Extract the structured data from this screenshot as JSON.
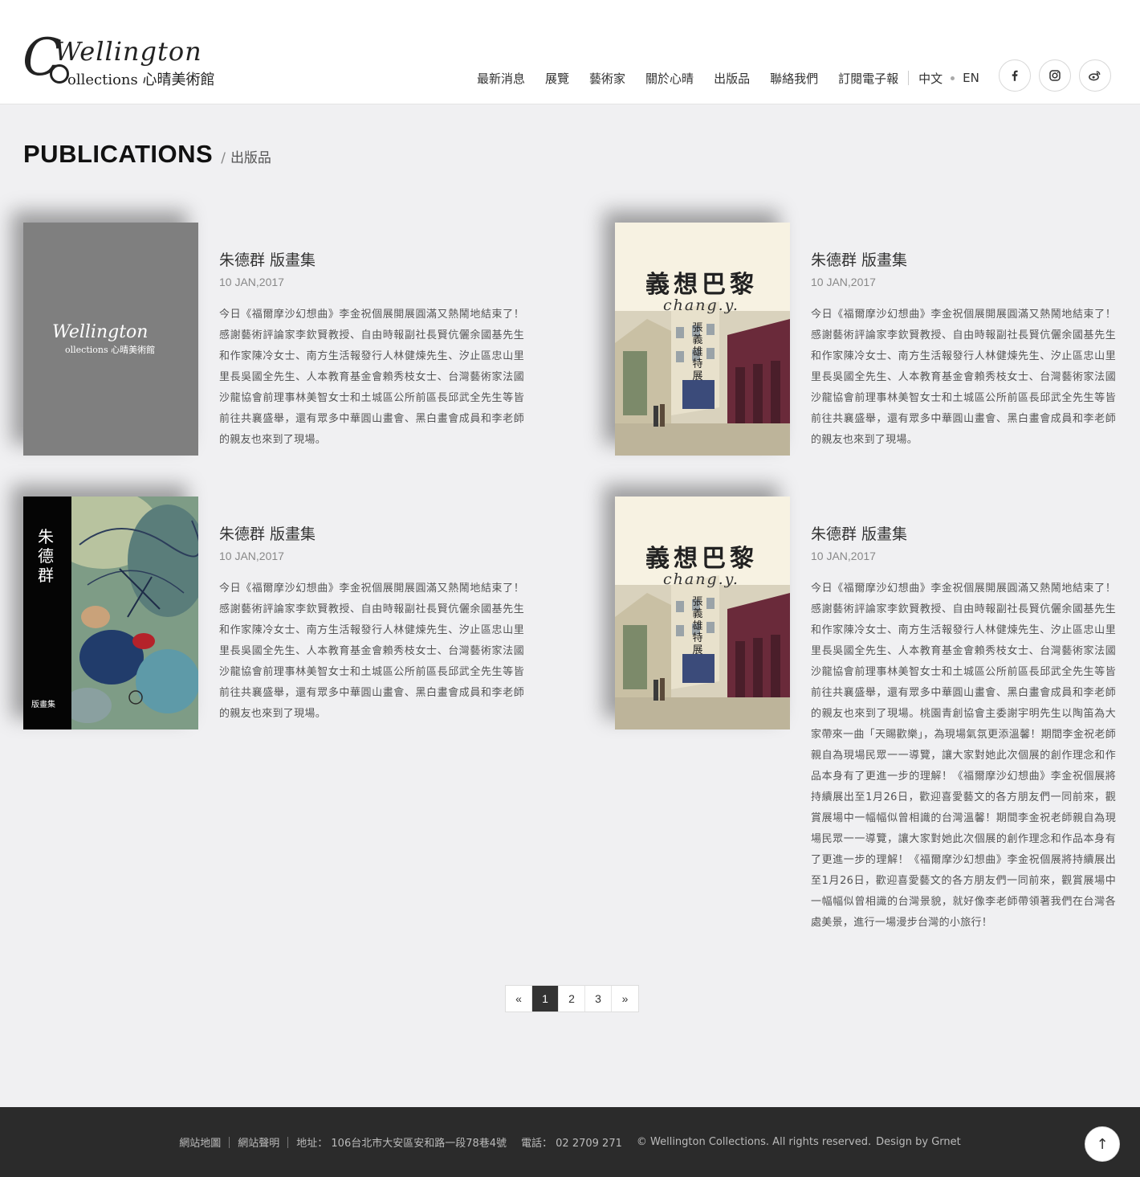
{
  "header": {
    "logo": {
      "word": "Wellington",
      "sub": "ollections 心晴美術館"
    },
    "nav": [
      "最新消息",
      "展覽",
      "藝術家",
      "關於心晴",
      "出版品",
      "聯絡我們",
      "訂閱電子報"
    ],
    "lang": {
      "zh": "中文",
      "en": "EN"
    },
    "social": [
      "facebook-icon",
      "instagram-icon",
      "weibo-icon"
    ]
  },
  "page": {
    "title_en": "PUBLICATIONS",
    "slash": "/",
    "title_zh": "出版品"
  },
  "publications": [
    {
      "cover": "wellington-logo-cover",
      "cover_text": {
        "word": "Wellington",
        "sub": "ollections 心晴美術館"
      },
      "title": "朱德群 版畫集",
      "date": "10 JAN,2017",
      "body": "今日《福爾摩沙幻想曲》李金祝個展開展圓滿又熱鬧地結束了！感謝藝術評論家李欽賢教授、自由時報副社長賢伉儷余國基先生和作家陳冷女士、南方生活報發行人林健煉先生、汐止區忠山里里長吳國全先生、人本教育基金會賴秀枝女士、台灣藝術家法國沙龍協會前理事林美智女士和土城區公所前區長邱武全先生等皆前往共襄盛舉，還有眾多中華圓山畫會、黑白畫會成員和李老師的親友也來到了現場。"
    },
    {
      "cover": "paris-cover",
      "cover_text": {
        "title": "義想巴黎",
        "signature": "chang.y.",
        "vertical": "張義雄特展"
      },
      "title": "朱德群 版畫集",
      "date": "10 JAN,2017",
      "body": "今日《福爾摩沙幻想曲》李金祝個展開展圓滿又熱鬧地結束了！感謝藝術評論家李欽賢教授、自由時報副社長賢伉儷余國基先生和作家陳冷女士、南方生活報發行人林健煉先生、汐止區忠山里里長吳國全先生、人本教育基金會賴秀枝女士、台灣藝術家法國沙龍協會前理事林美智女士和土城區公所前區長邱武全先生等皆前往共襄盛舉，還有眾多中華圓山畫會、黑白畫會成員和李老師的親友也來到了現場。"
    },
    {
      "cover": "zhu-dequn-cover",
      "cover_text": {
        "vertical": "朱德群",
        "bottom": "版畫集"
      },
      "title": "朱德群 版畫集",
      "date": "10 JAN,2017",
      "body": "今日《福爾摩沙幻想曲》李金祝個展開展圓滿又熱鬧地結束了！感謝藝術評論家李欽賢教授、自由時報副社長賢伉儷余國基先生和作家陳冷女士、南方生活報發行人林健煉先生、汐止區忠山里里長吳國全先生、人本教育基金會賴秀枝女士、台灣藝術家法國沙龍協會前理事林美智女士和土城區公所前區長邱武全先生等皆前往共襄盛舉，還有眾多中華圓山畫會、黑白畫會成員和李老師的親友也來到了現場。"
    },
    {
      "cover": "paris-cover",
      "cover_text": {
        "title": "義想巴黎",
        "signature": "chang.y.",
        "vertical": "張義雄特展"
      },
      "title": "朱德群 版畫集",
      "date": "10 JAN,2017",
      "body": "今日《福爾摩沙幻想曲》李金祝個展開展圓滿又熱鬧地結束了！感謝藝術評論家李欽賢教授、自由時報副社長賢伉儷余國基先生和作家陳冷女士、南方生活報發行人林健煉先生、汐止區忠山里里長吳國全先生、人本教育基金會賴秀枝女士、台灣藝術家法國沙龍協會前理事林美智女士和土城區公所前區長邱武全先生等皆前往共襄盛舉，還有眾多中華圓山畫會、黑白畫會成員和李老師的親友也來到了現場。桃園青創協會主委謝宇明先生以陶笛為大家帶來一曲「天賜歡樂」，為現場氣氛更添溫馨！期間李金祝老師親自為現場民眾一一導覽，讓大家對她此次個展的創作理念和作品本身有了更進一步的理解！《福爾摩沙幻想曲》李金祝個展將持續展出至1月26日，歡迎喜愛藝文的各方朋友們一同前來，觀賞展場中一幅幅似曾相識的台灣溫馨！期間李金祝老師親自為現場民眾一一導覽，讓大家對她此次個展的創作理念和作品本身有了更進一步的理解！《福爾摩沙幻想曲》李金祝個展將持續展出至1月26日，歡迎喜愛藝文的各方朋友們一同前來，觀賞展場中一幅幅似曾相識的台灣景貌，就好像李老師帶領著我們在台灣各處美景，進行一場漫步台灣的小旅行！"
    }
  ],
  "pagination": {
    "prev": "«",
    "pages": [
      "1",
      "2",
      "3"
    ],
    "current": "1",
    "next": "»"
  },
  "footer": {
    "sitemap": "網站地圖",
    "statement": "網站聲明",
    "address": "地址： 106台北市大安區安和路一段78巷4號",
    "phone": "電話： 02 2709 271",
    "copyright": "© Wellington Collections.  All rights reserved.",
    "design": "Design by Grnet",
    "to_top": "↑"
  }
}
